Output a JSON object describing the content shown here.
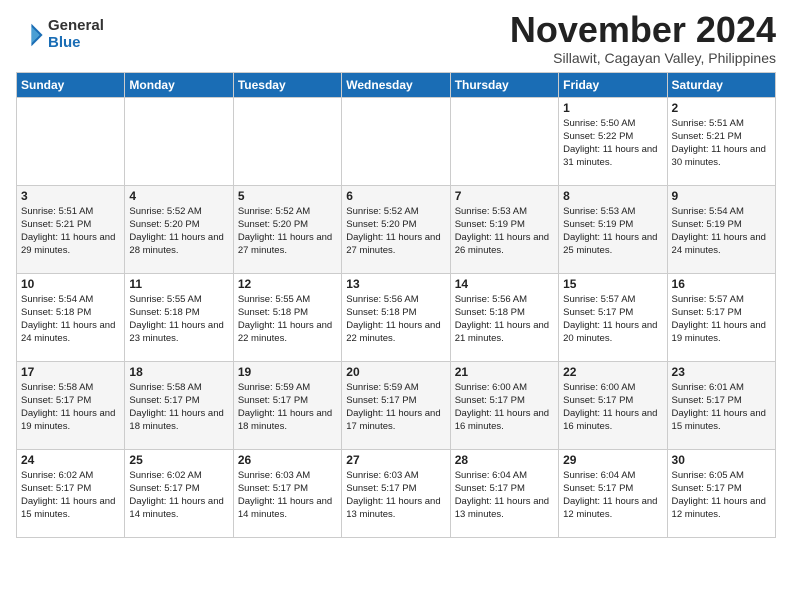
{
  "header": {
    "logo_line1": "General",
    "logo_line2": "Blue",
    "month": "November 2024",
    "location": "Sillawit, Cagayan Valley, Philippines"
  },
  "weekdays": [
    "Sunday",
    "Monday",
    "Tuesday",
    "Wednesday",
    "Thursday",
    "Friday",
    "Saturday"
  ],
  "weeks": [
    [
      {
        "day": "",
        "info": ""
      },
      {
        "day": "",
        "info": ""
      },
      {
        "day": "",
        "info": ""
      },
      {
        "day": "",
        "info": ""
      },
      {
        "day": "",
        "info": ""
      },
      {
        "day": "1",
        "info": "Sunrise: 5:50 AM\nSunset: 5:22 PM\nDaylight: 11 hours and 31 minutes."
      },
      {
        "day": "2",
        "info": "Sunrise: 5:51 AM\nSunset: 5:21 PM\nDaylight: 11 hours and 30 minutes."
      }
    ],
    [
      {
        "day": "3",
        "info": "Sunrise: 5:51 AM\nSunset: 5:21 PM\nDaylight: 11 hours and 29 minutes."
      },
      {
        "day": "4",
        "info": "Sunrise: 5:52 AM\nSunset: 5:20 PM\nDaylight: 11 hours and 28 minutes."
      },
      {
        "day": "5",
        "info": "Sunrise: 5:52 AM\nSunset: 5:20 PM\nDaylight: 11 hours and 27 minutes."
      },
      {
        "day": "6",
        "info": "Sunrise: 5:52 AM\nSunset: 5:20 PM\nDaylight: 11 hours and 27 minutes."
      },
      {
        "day": "7",
        "info": "Sunrise: 5:53 AM\nSunset: 5:19 PM\nDaylight: 11 hours and 26 minutes."
      },
      {
        "day": "8",
        "info": "Sunrise: 5:53 AM\nSunset: 5:19 PM\nDaylight: 11 hours and 25 minutes."
      },
      {
        "day": "9",
        "info": "Sunrise: 5:54 AM\nSunset: 5:19 PM\nDaylight: 11 hours and 24 minutes."
      }
    ],
    [
      {
        "day": "10",
        "info": "Sunrise: 5:54 AM\nSunset: 5:18 PM\nDaylight: 11 hours and 24 minutes."
      },
      {
        "day": "11",
        "info": "Sunrise: 5:55 AM\nSunset: 5:18 PM\nDaylight: 11 hours and 23 minutes."
      },
      {
        "day": "12",
        "info": "Sunrise: 5:55 AM\nSunset: 5:18 PM\nDaylight: 11 hours and 22 minutes."
      },
      {
        "day": "13",
        "info": "Sunrise: 5:56 AM\nSunset: 5:18 PM\nDaylight: 11 hours and 22 minutes."
      },
      {
        "day": "14",
        "info": "Sunrise: 5:56 AM\nSunset: 5:18 PM\nDaylight: 11 hours and 21 minutes."
      },
      {
        "day": "15",
        "info": "Sunrise: 5:57 AM\nSunset: 5:17 PM\nDaylight: 11 hours and 20 minutes."
      },
      {
        "day": "16",
        "info": "Sunrise: 5:57 AM\nSunset: 5:17 PM\nDaylight: 11 hours and 19 minutes."
      }
    ],
    [
      {
        "day": "17",
        "info": "Sunrise: 5:58 AM\nSunset: 5:17 PM\nDaylight: 11 hours and 19 minutes."
      },
      {
        "day": "18",
        "info": "Sunrise: 5:58 AM\nSunset: 5:17 PM\nDaylight: 11 hours and 18 minutes."
      },
      {
        "day": "19",
        "info": "Sunrise: 5:59 AM\nSunset: 5:17 PM\nDaylight: 11 hours and 18 minutes."
      },
      {
        "day": "20",
        "info": "Sunrise: 5:59 AM\nSunset: 5:17 PM\nDaylight: 11 hours and 17 minutes."
      },
      {
        "day": "21",
        "info": "Sunrise: 6:00 AM\nSunset: 5:17 PM\nDaylight: 11 hours and 16 minutes."
      },
      {
        "day": "22",
        "info": "Sunrise: 6:00 AM\nSunset: 5:17 PM\nDaylight: 11 hours and 16 minutes."
      },
      {
        "day": "23",
        "info": "Sunrise: 6:01 AM\nSunset: 5:17 PM\nDaylight: 11 hours and 15 minutes."
      }
    ],
    [
      {
        "day": "24",
        "info": "Sunrise: 6:02 AM\nSunset: 5:17 PM\nDaylight: 11 hours and 15 minutes."
      },
      {
        "day": "25",
        "info": "Sunrise: 6:02 AM\nSunset: 5:17 PM\nDaylight: 11 hours and 14 minutes."
      },
      {
        "day": "26",
        "info": "Sunrise: 6:03 AM\nSunset: 5:17 PM\nDaylight: 11 hours and 14 minutes."
      },
      {
        "day": "27",
        "info": "Sunrise: 6:03 AM\nSunset: 5:17 PM\nDaylight: 11 hours and 13 minutes."
      },
      {
        "day": "28",
        "info": "Sunrise: 6:04 AM\nSunset: 5:17 PM\nDaylight: 11 hours and 13 minutes."
      },
      {
        "day": "29",
        "info": "Sunrise: 6:04 AM\nSunset: 5:17 PM\nDaylight: 11 hours and 12 minutes."
      },
      {
        "day": "30",
        "info": "Sunrise: 6:05 AM\nSunset: 5:17 PM\nDaylight: 11 hours and 12 minutes."
      }
    ]
  ]
}
